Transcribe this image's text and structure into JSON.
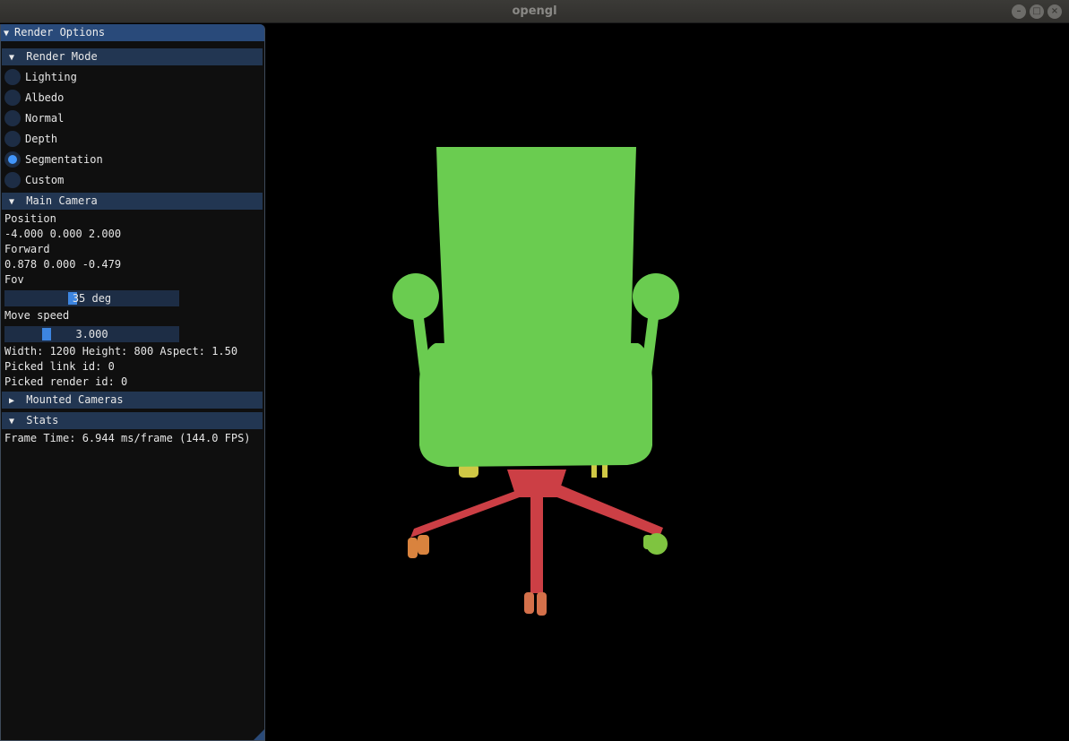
{
  "window": {
    "title": "opengl",
    "buttons": [
      "–",
      "□",
      "×"
    ]
  },
  "panel": {
    "title": "Render Options",
    "render_mode": {
      "header": "Render Mode",
      "options": [
        "Lighting",
        "Albedo",
        "Normal",
        "Depth",
        "Segmentation",
        "Custom"
      ],
      "selected": "Segmentation"
    },
    "main_camera": {
      "header": "Main Camera",
      "position_label": "Position",
      "position_value": "-4.000 0.000 2.000",
      "forward_label": "Forward",
      "forward_value": "0.878 0.000 -0.479",
      "fov_label": "Fov",
      "fov_value": "35 deg",
      "move_speed_label": "Move speed",
      "move_speed_value": "3.000",
      "size_info": "Width: 1200 Height: 800 Aspect: 1.50",
      "picked_link": "Picked link id: 0",
      "picked_render": "Picked render id: 0"
    },
    "mounted_cameras": {
      "header": "Mounted Cameras"
    },
    "stats": {
      "header": "Stats",
      "frame_time": "Frame Time: 6.944 ms/frame (144.0 FPS)"
    }
  },
  "colors": {
    "seat_green": "#6acc50",
    "base_red": "#cc3f45",
    "wheel_orange": "#d9833e",
    "wheel_yellow": "#d0c845",
    "wheel_lime": "#7fc440",
    "wheel_salmon": "#d4704a"
  }
}
